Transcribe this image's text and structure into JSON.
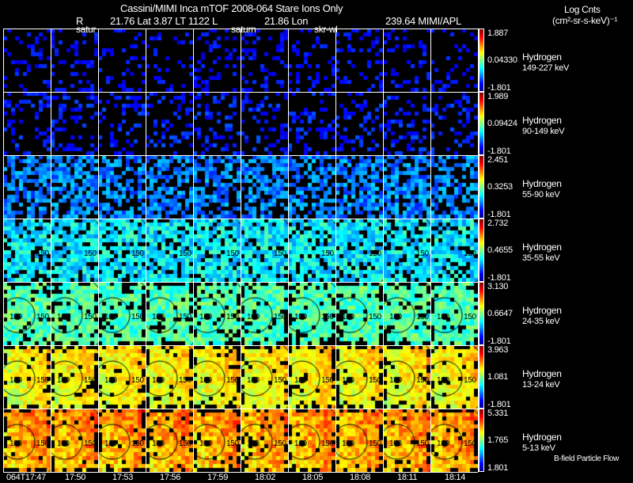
{
  "header": {
    "title": "Cassini/MIMI Inca mTOF  2008-064   Stare   Ions Only",
    "ephemeris": {
      "r_label": "R",
      "r_lat": "21.76 Lat 3.87 LT 1122 L",
      "l_lon": "21.86 Lon",
      "lon_source": "239.64  MIMI/APL"
    },
    "markers": [
      "satur",
      "saturn",
      "skr-wl"
    ]
  },
  "units": {
    "line1": "Log Cnts",
    "line2": "(cm²-sr-s-keV)⁻¹"
  },
  "footer_note": "B-field Particle Flow",
  "chart_data": {
    "type": "heatmap",
    "title": "Cassini/MIMI Inca mTOF  2008-064   Stare   Ions Only",
    "colormap": "jet",
    "times": [
      "064T17:47",
      "17:50",
      "17:53",
      "17:56",
      "17:59",
      "18:02",
      "18:05",
      "18:08",
      "18:11",
      "18:14"
    ],
    "rows": [
      {
        "species": "Hydrogen",
        "energy": "149-227 keV",
        "cbar_max": "1.887",
        "cbar_mid": "0.04330",
        "cbar_min": "-1.801",
        "contours": []
      },
      {
        "species": "Hydrogen",
        "energy": "90-149 keV",
        "cbar_max": "1.989",
        "cbar_mid": "0.09424",
        "cbar_min": "-1.801",
        "contours": []
      },
      {
        "species": "Hydrogen",
        "energy": "55-90 keV",
        "cbar_max": "2.451",
        "cbar_mid": "0.3253",
        "cbar_min": "-1.801",
        "contours": []
      },
      {
        "species": "Hydrogen",
        "energy": "35-55 keV",
        "cbar_max": "2.732",
        "cbar_mid": "0.4655",
        "cbar_min": "-1.801",
        "contours": [
          "150"
        ]
      },
      {
        "species": "Hydrogen",
        "energy": "24-35 keV",
        "cbar_max": "3.130",
        "cbar_mid": "0.6647",
        "cbar_min": "-1.801",
        "contours": [
          "180",
          "150"
        ]
      },
      {
        "species": "Hydrogen",
        "energy": "13-24 keV",
        "cbar_max": "3.963",
        "cbar_mid": "1.081",
        "cbar_min": "-1.801",
        "contours": [
          "180",
          "150"
        ]
      },
      {
        "species": "Hydrogen",
        "energy": "5-13 keV",
        "cbar_max": "5.331",
        "cbar_mid": "1.765",
        "cbar_min": "1.801",
        "contours": [
          "180",
          "150"
        ]
      }
    ]
  }
}
